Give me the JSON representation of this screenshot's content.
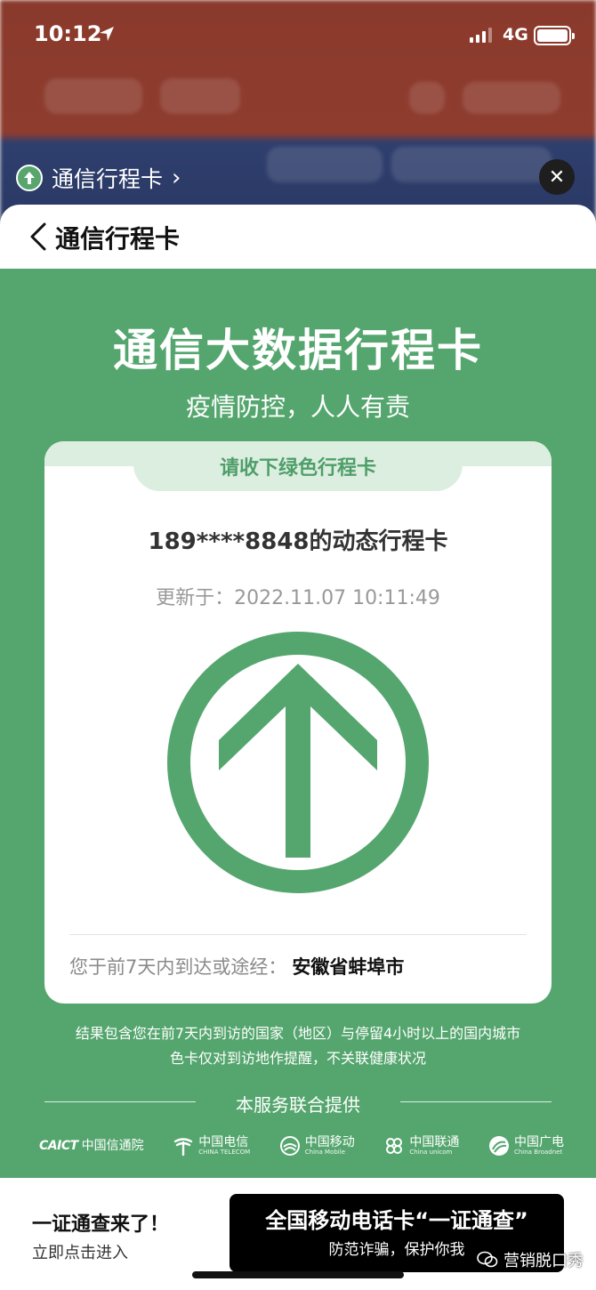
{
  "status_bar": {
    "time": "10:12",
    "network": "4G"
  },
  "mini_program": {
    "title": "通信行程卡"
  },
  "nav": {
    "title": "通信行程卡"
  },
  "header": {
    "title": "通信大数据行程卡",
    "slogan": "疫情防控，人人有责"
  },
  "card": {
    "tab": "请收下绿色行程卡",
    "phone_line": "189****8848的动态行程卡",
    "updated": "更新于：2022.11.07 10:11:49",
    "route_label": "您于前7天内到达或途经：",
    "route_value": "安徽省蚌埠市",
    "arrow_color": "#55a66e"
  },
  "notes": [
    "结果包含您在前7天内到访的国家（地区）与停留4小时以上的国内城市",
    "色卡仅对到访地作提醒，不关联健康状况"
  ],
  "providers": {
    "heading": "本服务联合提供",
    "logos": [
      {
        "icon": "caict-logo-icon",
        "mark": "CAICT",
        "name": "中国信通院",
        "sub": ""
      },
      {
        "icon": "china-telecom-icon",
        "mark": "",
        "name": "中国电信",
        "sub": "CHINA TELECOM"
      },
      {
        "icon": "china-mobile-icon",
        "mark": "",
        "name": "中国移动",
        "sub": "China Mobile"
      },
      {
        "icon": "china-unicom-icon",
        "mark": "",
        "name": "中国联通",
        "sub": "China unicom"
      },
      {
        "icon": "china-broadnet-icon",
        "mark": "",
        "name": "中国广电",
        "sub": "China Broadnet"
      }
    ]
  },
  "promo": {
    "title": "一证通查来了！",
    "subtitle": "立即点击进入",
    "card_title": "全国移动电话卡“一证通查”",
    "card_subtitle": "防范诈骗，保护你我"
  },
  "watermark": {
    "text": "营销脱口秀"
  },
  "colors": {
    "green": "#55a66e",
    "banner": "#dbeee0"
  }
}
